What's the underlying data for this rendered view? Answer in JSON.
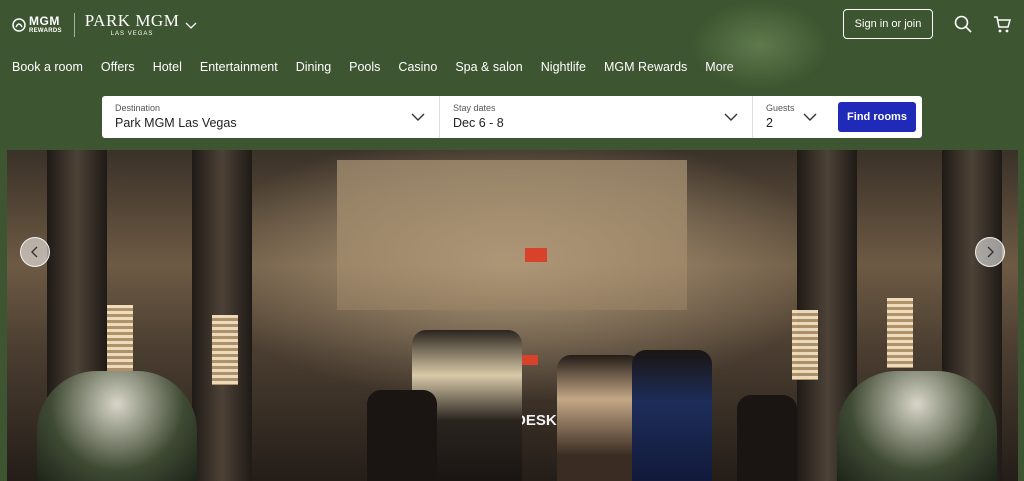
{
  "header": {
    "mgm_logo_line1": "MGM",
    "mgm_logo_line2": "REWARDS",
    "property_name": "PARK MGM",
    "property_sub": "LAS VEGAS",
    "signin_label": "Sign in or join",
    "icons": [
      "search-icon",
      "cart-icon",
      "chevron-down-icon"
    ]
  },
  "nav": {
    "items": [
      "Book a room",
      "Offers",
      "Hotel",
      "Entertainment",
      "Dining",
      "Pools",
      "Casino",
      "Spa & salon",
      "Nightlife",
      "MGM Rewards",
      "More"
    ]
  },
  "booking": {
    "destination_label": "Destination",
    "destination_value": "Park MGM Las Vegas",
    "dates_label": "Stay dates",
    "dates_value": "Dec 6 - 8",
    "guests_label": "Guests",
    "guests_value": "2",
    "find_label": "Find rooms"
  },
  "hero": {
    "sign_text": "DESK",
    "icons": [
      "chevron-left-icon",
      "chevron-right-icon"
    ]
  },
  "colors": {
    "header_bg": "#3d5530",
    "find_button": "#1f2ab8"
  }
}
